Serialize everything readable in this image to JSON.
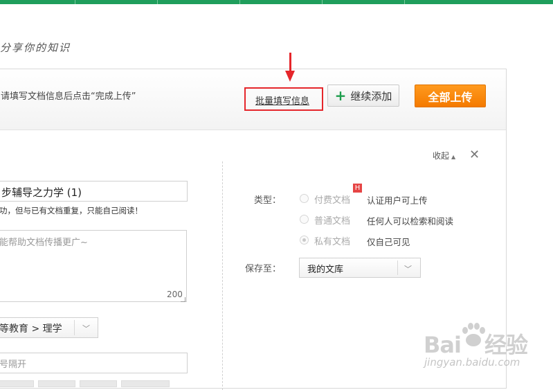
{
  "slogan": "分享你的知识",
  "header": {
    "hint": "请填写文档信息后点击“完成上传”",
    "batch_link": "批量填写信息",
    "continue_label": "继续添加",
    "continue_icon": "plus-icon",
    "upload_all_label": "全部上传",
    "accent_color": "#1f9e5c",
    "primary_color": "#f47a00",
    "highlight_color": "#e5262b"
  },
  "panel": {
    "collapse_label": "收起",
    "close_icon": "close-icon"
  },
  "form": {
    "title_value": "步辅导之力学 (1)",
    "title_note": "功，但与已有文档重复，只能自己阅读！",
    "description_placeholder": "能帮助文档传播更广~",
    "description_remaining": "200",
    "category_value": "等教育 > 理学",
    "tags_placeholder": "号隔开"
  },
  "settings": {
    "type_label": "类型：",
    "options": [
      {
        "name": "付费文档",
        "desc": "认证用户可上传",
        "badge": "H",
        "checked": false
      },
      {
        "name": "普通文档",
        "desc": "任何人可以检索和阅读",
        "checked": false
      },
      {
        "name": "私有文档",
        "desc": "仅自己可见",
        "checked": true
      }
    ],
    "save_label": "保存至：",
    "save_value": "我的文库"
  },
  "watermark": {
    "logo_a": "Bai",
    "logo_b": "经验",
    "url": "jingyan.baidu.com"
  }
}
